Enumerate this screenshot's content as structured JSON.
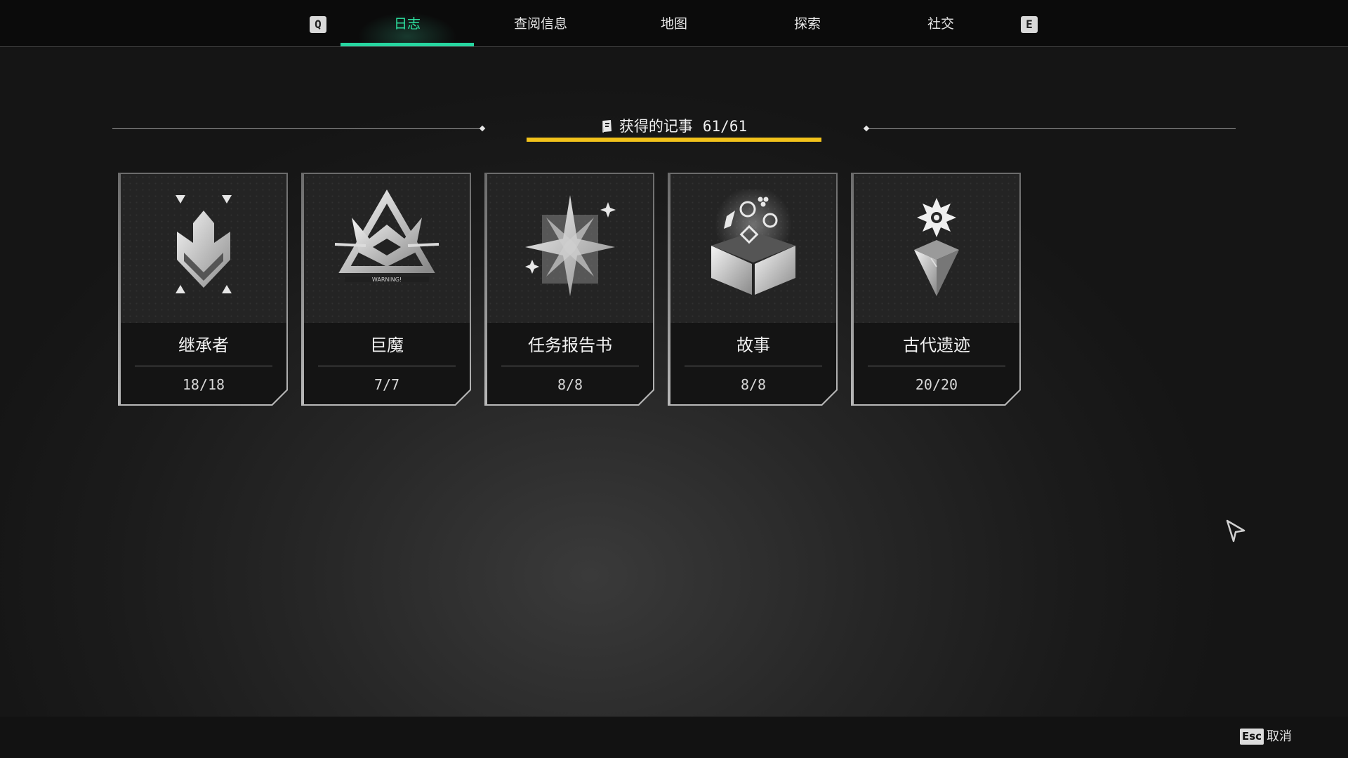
{
  "nav": {
    "left_key": "Q",
    "right_key": "E",
    "tabs": [
      {
        "label": "日志",
        "active": true
      },
      {
        "label": "查阅信息",
        "active": false
      },
      {
        "label": "地图",
        "active": false
      },
      {
        "label": "探索",
        "active": false
      },
      {
        "label": "社交",
        "active": false
      }
    ]
  },
  "header": {
    "title": "获得的记事",
    "count": "61/61",
    "icon": "book-icon"
  },
  "cards": [
    {
      "name": "继承者",
      "progress": "18/18",
      "icon": "chevron-emblem-icon"
    },
    {
      "name": "巨魔",
      "progress": "7/7",
      "icon": "warning-monster-icon",
      "icon_text": "WARNING!"
    },
    {
      "name": "任务报告书",
      "progress": "8/8",
      "icon": "star-compass-icon"
    },
    {
      "name": "故事",
      "progress": "8/8",
      "icon": "open-box-icon"
    },
    {
      "name": "古代遗迹",
      "progress": "20/20",
      "icon": "crystal-gear-icon"
    }
  ],
  "footer": {
    "esc_key": "Esc",
    "cancel_label": "取消"
  },
  "colors": {
    "accent_tab": "#27d6a0",
    "header_underline": "#f2c21b"
  }
}
